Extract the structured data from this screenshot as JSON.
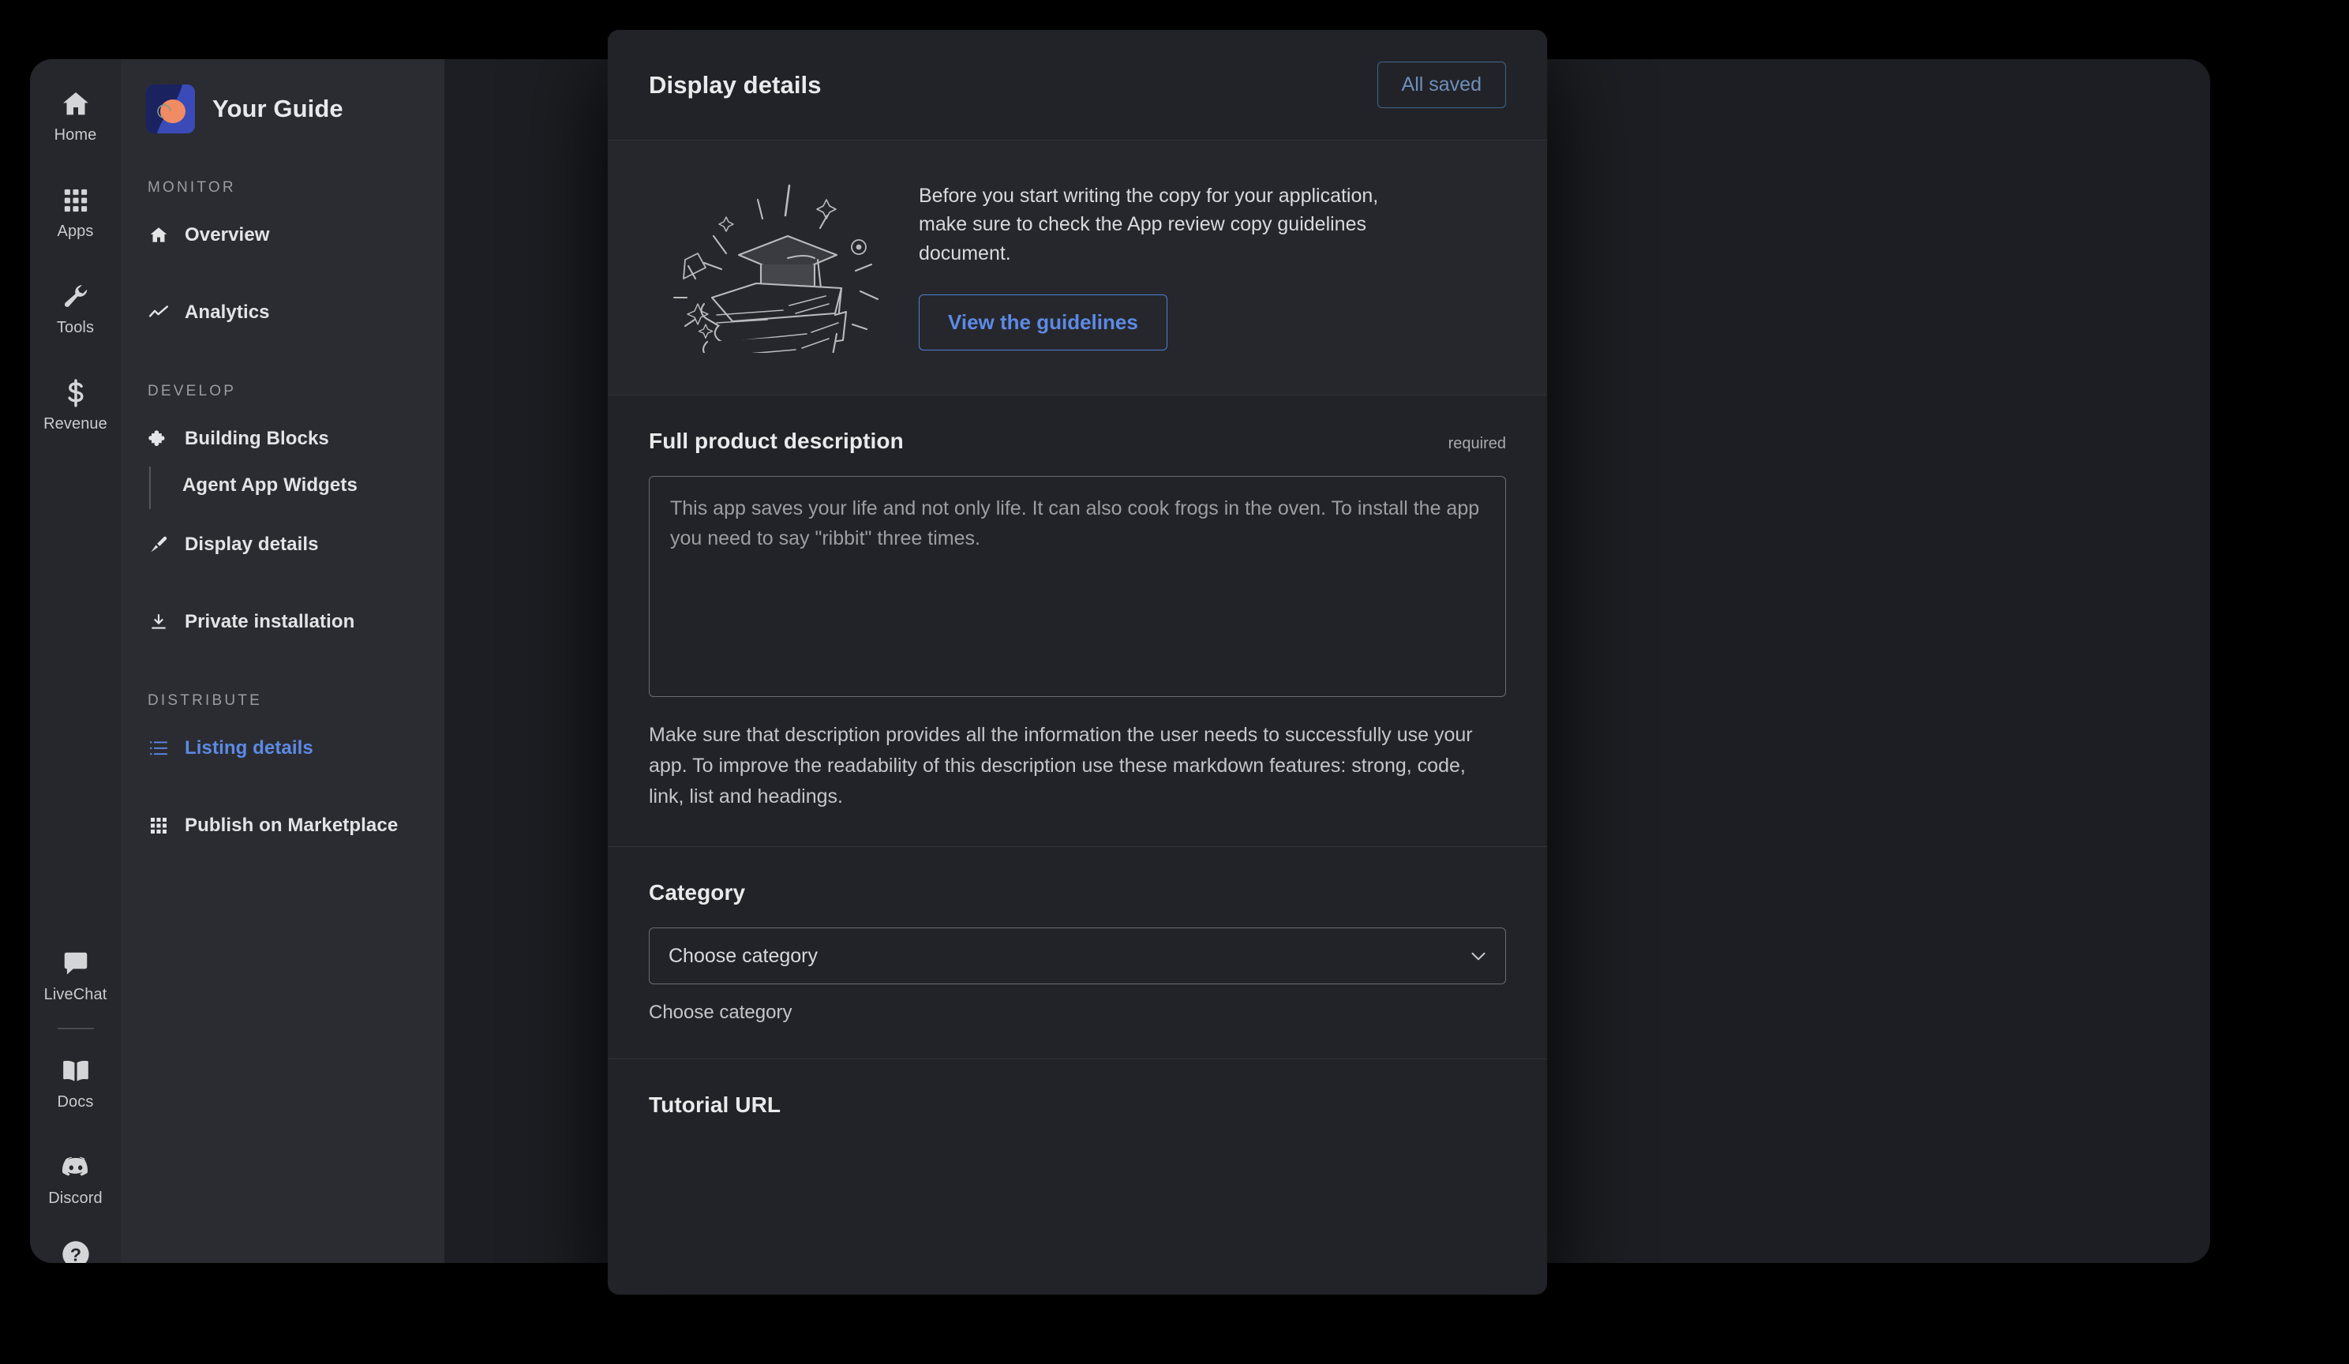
{
  "rail": {
    "items": [
      {
        "label": "Home",
        "icon": "home-icon"
      },
      {
        "label": "Apps",
        "icon": "grid-icon"
      },
      {
        "label": "Tools",
        "icon": "wrench-icon"
      },
      {
        "label": "Revenue",
        "icon": "dollar-icon"
      }
    ],
    "bottom_items": [
      {
        "label": "LiveChat",
        "icon": "chat-bubble-icon"
      },
      {
        "label": "Docs",
        "icon": "book-icon"
      },
      {
        "label": "Discord",
        "icon": "discord-icon"
      }
    ],
    "help": {
      "label": "",
      "icon": "help-circle-icon"
    }
  },
  "nav": {
    "brand_title": "Your Guide",
    "brand_logo_icon": "app-avatar",
    "groups": [
      {
        "label": "MONITOR",
        "items": [
          {
            "label": "Overview",
            "icon": "home-icon",
            "active": false
          },
          {
            "label": "Analytics",
            "icon": "trend-line-icon",
            "active": false
          }
        ]
      },
      {
        "label": "DEVELOP",
        "items": [
          {
            "label": "Building Blocks",
            "icon": "puzzle-icon",
            "active": false
          },
          {
            "label": "Display details",
            "icon": "brush-icon",
            "active": false
          },
          {
            "label": "Private installation",
            "icon": "download-icon",
            "active": false
          }
        ],
        "subitem": {
          "label": "Agent App Widgets",
          "parent": "Building Blocks"
        }
      },
      {
        "label": "DISTRIBUTE",
        "items": [
          {
            "label": "Listing details",
            "icon": "list-icon",
            "active": true
          },
          {
            "label": "Publish on Marketplace",
            "icon": "grid-icon",
            "active": false
          }
        ]
      }
    ]
  },
  "modal": {
    "title": "Display details",
    "save_status_label": "All saved",
    "banner": {
      "illustration_icon": "graduation-books-illustration",
      "text": "Before you start writing the copy for your application, make sure to check the App review copy guidelines document.",
      "button_label": "View the guidelines"
    },
    "description_section": {
      "title": "Full product description",
      "required_label": "required",
      "placeholder": "This app saves your life and not only life. It can also cook frogs in the oven. To install the app you need to say \"ribbit\" three times.",
      "value": "",
      "hint": "Make sure that description provides all the information the user needs to successfully use your app. To improve the readability of this description use these markdown features: strong, code, link, list and headings."
    },
    "category_section": {
      "title": "Category",
      "selected_option": "Choose category",
      "options": [
        "Choose category"
      ],
      "hint": "Choose category",
      "chevron_icon": "chevron-down-icon"
    },
    "tutorial_section": {
      "title": "Tutorial URL"
    }
  },
  "colors": {
    "accent_blue": "#5c8ae6",
    "muted_blue": "#6d8fba",
    "window_bg": "#1d1e23",
    "rail_bg": "#26272c",
    "nav_bg": "#2b2c31",
    "modal_bg": "#222328",
    "banner_bg": "#26272c",
    "divider": "#313237"
  }
}
